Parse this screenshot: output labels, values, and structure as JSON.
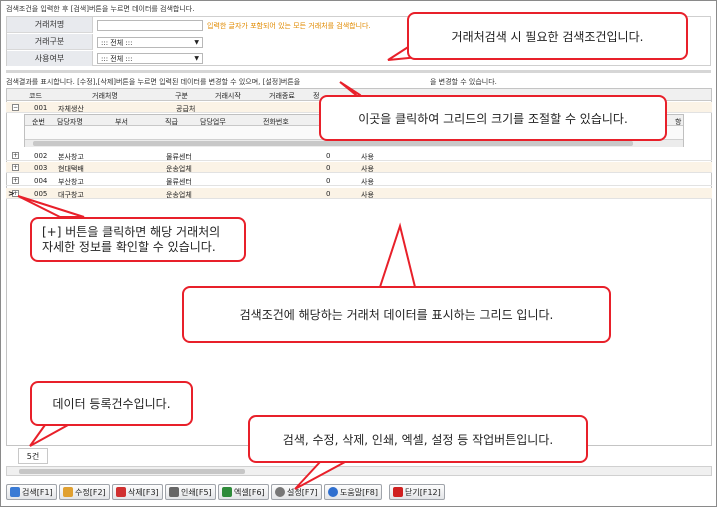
{
  "search": {
    "header": "검색조건을 입력한 후 [검색]버튼을 누르면 데이터를 검색합니다.",
    "fields": [
      {
        "label": "거래처명",
        "value": "",
        "hint": "입력한 글자가 포함되어 있는 모든 거래처를 검색합니다."
      },
      {
        "label": "거래구분",
        "value": "::: 전체 :::"
      },
      {
        "label": "사용여부",
        "value": "::: 전체 :::"
      }
    ]
  },
  "results": {
    "header": "검색결과를 표시합니다. [수정],[삭제]버튼을 누르면 입력된 데이터를 변경할 수 있으며, [설정]버튼을",
    "header_tail": "을 변경할 수 있습니다."
  },
  "grid": {
    "columns": [
      "코드",
      "거래처명",
      "구분",
      "거래시작",
      "거래종료",
      "정"
    ],
    "rows": [
      {
        "expand": "⊟",
        "code": "001",
        "name": "자체생산",
        "type": "공급처",
        "num": "",
        "use": ""
      },
      {
        "expand": "⊞",
        "code": "002",
        "name": "본사창고",
        "type": "물류센터",
        "num": "0",
        "use": "사용"
      },
      {
        "expand": "⊞",
        "code": "003",
        "name": "현대택배",
        "type": "운송업체",
        "num": "0",
        "use": "사용"
      },
      {
        "expand": "⊞",
        "code": "004",
        "name": "부산창고",
        "type": "물류센터",
        "num": "0",
        "use": "사용"
      },
      {
        "expand": "⊞",
        "code": "005",
        "name": "대구창고",
        "type": "운송업체",
        "num": "0",
        "use": "사용"
      }
    ],
    "sub_columns": [
      "순번",
      "담당자명",
      "부서",
      "직급",
      "담당업무",
      "전화번호"
    ],
    "sub_tail": "항",
    "count": "5건",
    "row_marker": ">"
  },
  "toolbar": [
    {
      "label": "검색[F1]",
      "icon": "magnifier-icon",
      "color": "#3a7bd5"
    },
    {
      "label": "수정[F2]",
      "icon": "pencil-icon",
      "color": "#e0a030"
    },
    {
      "label": "삭제[F3]",
      "icon": "delete-icon",
      "color": "#d03030"
    },
    {
      "label": "인쇄[F5]",
      "icon": "printer-icon",
      "color": "#666666"
    },
    {
      "label": "엑셀[F6]",
      "icon": "excel-icon",
      "color": "#2e8b3a"
    },
    {
      "label": "설정[F7]",
      "icon": "gear-icon",
      "color": "#777777"
    },
    {
      "label": "도움말[F8]",
      "icon": "help-icon",
      "color": "#2f6fcf"
    },
    {
      "label": "닫기[F12]",
      "icon": "close-icon",
      "color": "#d02020"
    }
  ],
  "callouts": {
    "search": "거래처검색 시 필요한 검색조건입니다.",
    "resize": "이곳을 클릭하여 그리드의 크기를 조절할 수 있습니다.",
    "detail": "[+] 버튼을 클릭하면 해당 거래처의 자세한 정보를 확인할 수 있습니다.",
    "grid": "검색조건에 해당하는 거래처 데이터를 표시하는 그리드 입니다.",
    "count": "데이터 등록건수입니다.",
    "toolbar": "검색, 수정, 삭제, 인쇄, 엑셀, 설정 등 작업버튼입니다."
  },
  "colors": {
    "callout_border": "#e8202a",
    "hint": "#e08a00",
    "alt_row": "#fbf3e6"
  }
}
